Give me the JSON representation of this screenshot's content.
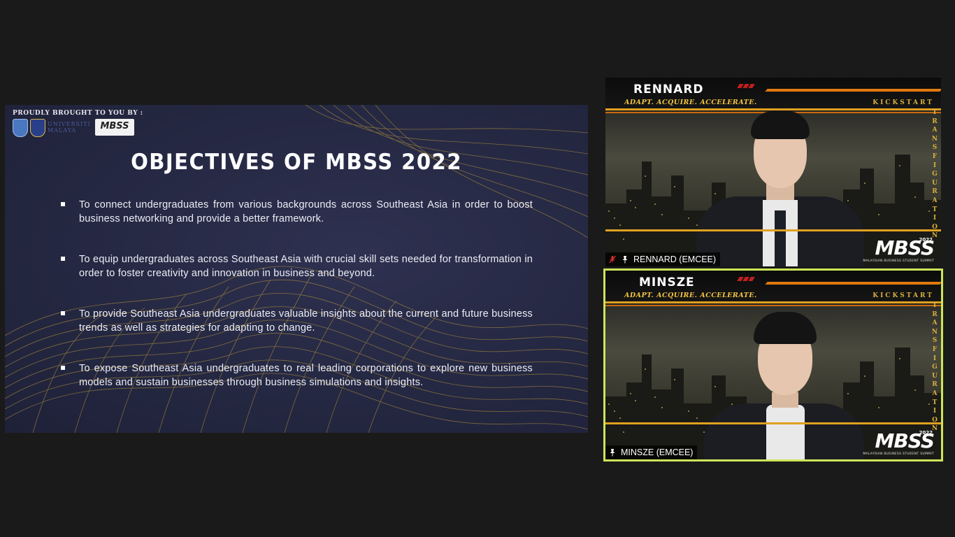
{
  "slide": {
    "brought_by": "PROUDLY BROUGHT TO YOU BY :",
    "logo_text_university": "UNIVERSITI",
    "logo_text_malaya": "MALAYA",
    "logo_mbss": "MBSS",
    "title": "OBJECTIVES OF MBSS 2022",
    "bullets": [
      "To connect undergraduates from various backgrounds across Southeast Asia in order to boost business networking and provide a better framework.",
      "To equip undergraduates across Southeast Asia with crucial skill sets needed for transformation in order to foster creativity and innovation in business and beyond.",
      "To provide Southeast Asia undergraduates valuable insights about the current and future business trends as well as strategies for adapting to change.",
      "To expose Southeast Asia undergraduates to real leading corporations to explore new business models and sustain businesses through business simulations and insights."
    ]
  },
  "participants": [
    {
      "banner_name": "RENNARD",
      "label": "RENNARD (EMCEE)",
      "muted": true,
      "pinned": true,
      "active_speaker": false
    },
    {
      "banner_name": "MINSZE",
      "label": "MINSZE (EMCEE)",
      "muted": false,
      "pinned": true,
      "active_speaker": true
    }
  ],
  "banner": {
    "tagline": "ADAPT. ACQUIRE. ACCELERATE.",
    "kickstart": "KICKSTART",
    "transfiguration": "TRANSFIGURATION",
    "logo": "MBSS",
    "logo_year": "2022",
    "logo_sub": "MALAYSIAN BUSINESS STUDENT SUMMIT"
  },
  "colors": {
    "active_speaker_border": "#cde55a",
    "slide_background": "#252842",
    "accent_gold": "#d8a53a"
  },
  "icons": {
    "muted": "mic-off-icon",
    "pinned": "pin-icon"
  }
}
